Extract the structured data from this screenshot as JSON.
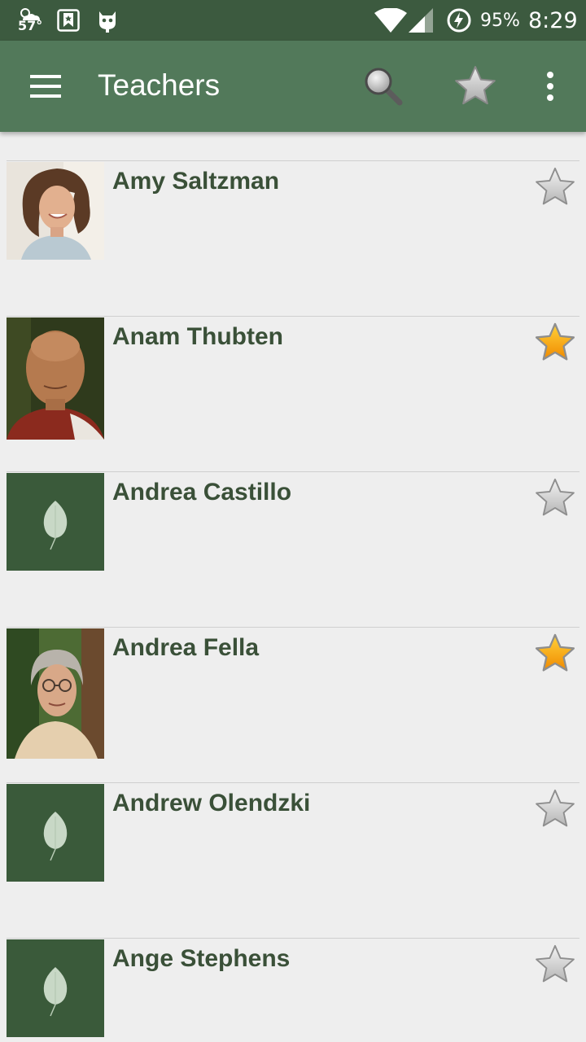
{
  "status_bar": {
    "temperature": "57°",
    "battery": "95%",
    "time": "8:29"
  },
  "toolbar": {
    "title": "Teachers",
    "icons": [
      "menu-icon",
      "search-icon",
      "star-icon",
      "more-vert-icon"
    ]
  },
  "colors": {
    "status_bar": "#3c5a3f",
    "toolbar": "#52795a",
    "name_text": "#3a5038",
    "favorite_on": "#f5a623",
    "placeholder_bg": "#3a5a3a"
  },
  "teachers": [
    {
      "name": "Amy Saltzman",
      "photo": "photo",
      "favorite": false
    },
    {
      "name": "Anam Thubten",
      "photo": "photo",
      "favorite": true
    },
    {
      "name": "Andrea Castillo",
      "photo": "leaf-placeholder",
      "favorite": false
    },
    {
      "name": "Andrea Fella",
      "photo": "photo",
      "favorite": true
    },
    {
      "name": "Andrew Olendzki",
      "photo": "leaf-placeholder",
      "favorite": false
    },
    {
      "name": "Ange Stephens",
      "photo": "leaf-placeholder",
      "favorite": false
    }
  ]
}
